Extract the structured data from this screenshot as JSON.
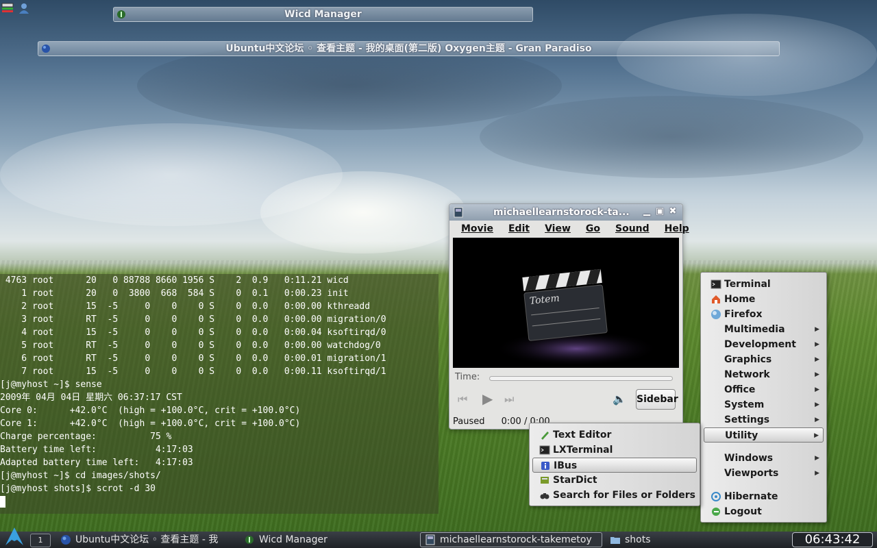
{
  "tray": {
    "icons": [
      "network-icon",
      "user-icon"
    ]
  },
  "windows": {
    "wicd_title": "Wicd Manager",
    "firefox_title": "Ubuntu中文论坛 ◦ 查看主题 - 我的桌面(第二版) Oxygen主题 - Gran Paradiso"
  },
  "terminal": {
    "lines": [
      " 4763 root      20   0 88788 8660 1956 S    2  0.9   0:11.21 wicd",
      "    1 root      20   0  3800  668  584 S    0  0.1   0:00.23 init",
      "    2 root      15  -5     0    0    0 S    0  0.0   0:00.00 kthreadd",
      "    3 root      RT  -5     0    0    0 S    0  0.0   0:00.00 migration/0",
      "    4 root      15  -5     0    0    0 S    0  0.0   0:00.04 ksoftirqd/0",
      "    5 root      RT  -5     0    0    0 S    0  0.0   0:00.00 watchdog/0",
      "    6 root      RT  -5     0    0    0 S    0  0.0   0:00.01 migration/1",
      "    7 root      15  -5     0    0    0 S    0  0.0   0:00.11 ksoftirqd/1",
      "[j@myhost ~]$ sense",
      "2009年 04月 04日 星期六 06:37:17 CST",
      "Core 0:      +42.0°C  (high = +100.0°C, crit = +100.0°C)",
      "Core 1:      +42.0°C  (high = +100.0°C, crit = +100.0°C)",
      "Charge percentage:          75 %",
      "Battery time left:           4:17:03",
      "Adapted battery time left:   4:17:03",
      "[j@myhost ~]$ cd images/shots/",
      "[j@myhost shots]$ scrot -d 30",
      ""
    ]
  },
  "totem": {
    "title": "michaellearnstorock-ta...",
    "menu": [
      "Movie",
      "Edit",
      "View",
      "Go",
      "Sound",
      "Help"
    ],
    "logo_text": "Totem",
    "time_label": "Time:",
    "sidebar_label": "Sidebar",
    "status": "Paused",
    "position": "0:00 / 0:00"
  },
  "main_menu": {
    "items": [
      {
        "label": "Terminal",
        "icon": "terminal-icon",
        "submenu": false
      },
      {
        "label": "Home",
        "icon": "home-icon",
        "submenu": false
      },
      {
        "label": "Firefox",
        "icon": "globe-icon",
        "submenu": false
      },
      {
        "label": "Multimedia",
        "submenu": true
      },
      {
        "label": "Development",
        "submenu": true
      },
      {
        "label": "Graphics",
        "submenu": true
      },
      {
        "label": "Network",
        "submenu": true
      },
      {
        "label": "Office",
        "submenu": true
      },
      {
        "label": "System",
        "submenu": true
      },
      {
        "label": "Settings",
        "submenu": true
      },
      {
        "label": "Utility",
        "submenu": true,
        "active": true
      },
      {
        "label": "Windows",
        "submenu": true
      },
      {
        "label": "Viewports",
        "submenu": true
      },
      {
        "label": "Hibernate",
        "icon": "hibernate-icon",
        "submenu": false
      },
      {
        "label": "Logout",
        "icon": "logout-icon",
        "submenu": false
      }
    ]
  },
  "sub_menu": {
    "items": [
      {
        "label": "Text Editor",
        "icon": "pen-icon"
      },
      {
        "label": "LXTerminal",
        "icon": "terminal-icon"
      },
      {
        "label": "IBus",
        "icon": "info-icon",
        "active": true
      },
      {
        "label": "StarDict",
        "icon": "book-icon"
      },
      {
        "label": "Search for Files or Folders",
        "icon": "binoculars-icon"
      }
    ]
  },
  "taskbar": {
    "desktop_number": "1",
    "tasks": [
      {
        "label": "Ubuntu中文论坛 ◦ 查看主题 - 我",
        "icon": "globe-icon"
      },
      {
        "label": "Wicd Manager",
        "icon": "wifi-icon"
      },
      {
        "label": "michaellearnstorock-takemetoy",
        "icon": "film-icon"
      },
      {
        "label": "shots",
        "icon": "folder-icon"
      }
    ],
    "clock": "06:43:42"
  },
  "colors": {
    "menu_active": "#d6d6d6",
    "taskbar": "#26292e",
    "terminal_bg": "#3c4628"
  }
}
